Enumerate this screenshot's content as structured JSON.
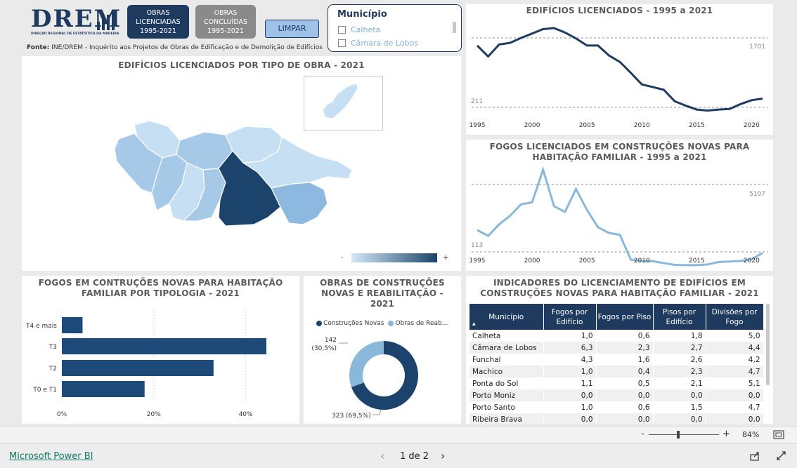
{
  "header": {
    "logo_text": "DREM",
    "logo_subtitle": "DIREÇÃO REGIONAL DE ESTATÍSTICA DA MADEIRA",
    "btn_licenciadas": [
      "OBRAS",
      "LICENCIADAS",
      "1995-2021"
    ],
    "btn_concluidas": [
      "OBRAS",
      "CONCLUÍDAS",
      "1995-2021"
    ],
    "btn_limpar": "LIMPAR",
    "source_label": "Fonte:",
    "source_text": "INE/DREM - Inquérito aos Projetos de Obras de Edificação e de Demolição de Edifícios"
  },
  "slicer": {
    "title": "Município",
    "items": [
      "Calheta",
      "Câmara de Lobos"
    ]
  },
  "map": {
    "title": "EDIFÍCIOS LICENCIADOS POR TIPO DE OBRA - 2021",
    "legend_min": "-",
    "legend_max": "+",
    "colors": {
      "light": "#c6dff3",
      "mid": "#8db8df",
      "dark": "#1c436b"
    }
  },
  "line1": {
    "title": "EDIFÍCIOS LICENCIADOS - 1995 a 2021",
    "ref_max": "1701",
    "ref_min": "211",
    "color": "#1e3a5f",
    "x_ticks": [
      "1995",
      "2000",
      "2005",
      "2010",
      "2015",
      "2020"
    ]
  },
  "line2": {
    "title_line1": "FOGOS LICENCIADOS EM CONSTRUÇÕES NOVAS PARA",
    "title_line2": "HABITAÇÃO FAMILIAR - 1995 a 2021",
    "ref_max": "5107",
    "ref_min": "113",
    "color": "#8ab8da",
    "x_ticks": [
      "1995",
      "2000",
      "2005",
      "2010",
      "2015",
      "2020"
    ]
  },
  "bar": {
    "title_line1": "FOGOS EM CONTRUÇÕES NOVAS PARA HABITAÇÃO",
    "title_line2": "FAMILIAR POR TIPOLOGIA - 2021",
    "x_ticks": [
      "0%",
      "20%",
      "40%"
    ],
    "color": "#1e4a7a"
  },
  "donut": {
    "title_line1": "OBRAS DE CONSTRUÇÕES",
    "title_line2": "NOVAS E REABILITAÇÃO -",
    "title_line3": "2021",
    "legend": [
      {
        "name": "Construções Novas",
        "color": "#1c436b"
      },
      {
        "name": "Obras de Reab...",
        "color": "#8ab8da"
      }
    ],
    "label_small_1": "142",
    "label_small_2": "(30,5%)",
    "label_big": "323 (69,5%)"
  },
  "table": {
    "title_line1": "INDICADORES DO LICENCIAMENTO DE EDIFÍCIOS EM",
    "title_line2": "CONSTRUÇÕES NOVAS PARA HABITAÇÃO FAMILIAR - 2021",
    "headers": [
      "Município",
      "Fogos por Edifício",
      "Fogos por Piso",
      "Pisos por Edifício",
      "Divisões por Fogo"
    ],
    "rows": [
      [
        "Calheta",
        "1,0",
        "0,6",
        "1,8",
        "5,0"
      ],
      [
        "Câmara de Lobos",
        "6,3",
        "2,3",
        "2,7",
        "4,4"
      ],
      [
        "Funchal",
        "4,3",
        "1,6",
        "2,6",
        "4,2"
      ],
      [
        "Machico",
        "1,0",
        "0,4",
        "2,3",
        "4,7"
      ],
      [
        "Ponta do Sol",
        "1,1",
        "0,5",
        "2,1",
        "5,1"
      ],
      [
        "Porto Moniz",
        "0,0",
        "0,0",
        "0,0",
        "0,0"
      ],
      [
        "Porto Santo",
        "1,0",
        "0,6",
        "1,5",
        "4,7"
      ],
      [
        "Ribeira Brava",
        "0,0",
        "0,0",
        "0,0",
        "0,0"
      ]
    ]
  },
  "zoom": {
    "minus": "-",
    "plus": "+",
    "level": "84%",
    "value": 0.84
  },
  "footer": {
    "brand": "Microsoft Power BI",
    "page_indicator": "1 de 2"
  },
  "chart_data": [
    {
      "type": "line",
      "title": "EDIFÍCIOS LICENCIADOS - 1995 a 2021",
      "x": [
        1995,
        1996,
        1997,
        1998,
        1999,
        2000,
        2001,
        2002,
        2003,
        2004,
        2005,
        2006,
        2007,
        2008,
        2009,
        2010,
        2011,
        2012,
        2013,
        2014,
        2015,
        2016,
        2017,
        2018,
        2019,
        2020,
        2021
      ],
      "series": [
        {
          "values": [
            1400,
            1200,
            1420,
            1450,
            1540,
            1620,
            1701,
            1720,
            1640,
            1530,
            1400,
            1400,
            1220,
            1100,
            900,
            690,
            640,
            590,
            380,
            300,
            230,
            211,
            230,
            240,
            330,
            400,
            430
          ]
        }
      ],
      "ylim": [
        0,
        1900
      ],
      "reference_lines": [
        1701,
        211
      ]
    },
    {
      "type": "line",
      "title": "FOGOS LICENCIADOS EM CONSTRUÇÕES NOVAS PARA HABITAÇÃO FAMILIAR - 1995 a 2021",
      "x": [
        1995,
        1996,
        1997,
        1998,
        1999,
        2000,
        2001,
        2002,
        2003,
        2004,
        2005,
        2006,
        2007,
        2008,
        2009,
        2010,
        2011,
        2012,
        2013,
        2014,
        2015,
        2016,
        2017,
        2018,
        2019,
        2020,
        2021
      ],
      "series": [
        {
          "values": [
            1950,
            1650,
            2250,
            2700,
            3300,
            3400,
            5107,
            3200,
            2900,
            4100,
            3000,
            2100,
            1800,
            1700,
            400,
            330,
            320,
            220,
            130,
            113,
            113,
            150,
            280,
            300,
            330,
            420,
            750
          ]
        }
      ],
      "ylim": [
        0,
        5800
      ],
      "reference_lines": [
        5107,
        113
      ]
    },
    {
      "type": "bar",
      "orientation": "horizontal",
      "title": "FOGOS EM CONTRUÇÕES NOVAS PARA HABITAÇÃO FAMILIAR POR TIPOLOGIA - 2021",
      "categories": [
        "T4 e mais",
        "T3",
        "T2",
        "T0 e T1"
      ],
      "values": [
        4.5,
        44.5,
        33,
        18
      ],
      "xlim": [
        0,
        50
      ],
      "x_ticks": [
        "0%",
        "20%",
        "40%"
      ]
    },
    {
      "type": "pie",
      "title": "OBRAS DE CONSTRUÇÕES NOVAS E REABILITAÇÃO - 2021",
      "categories": [
        "Construções Novas",
        "Obras de Reab..."
      ],
      "values": [
        323,
        142
      ],
      "percent": [
        69.5,
        30.5
      ]
    }
  ]
}
